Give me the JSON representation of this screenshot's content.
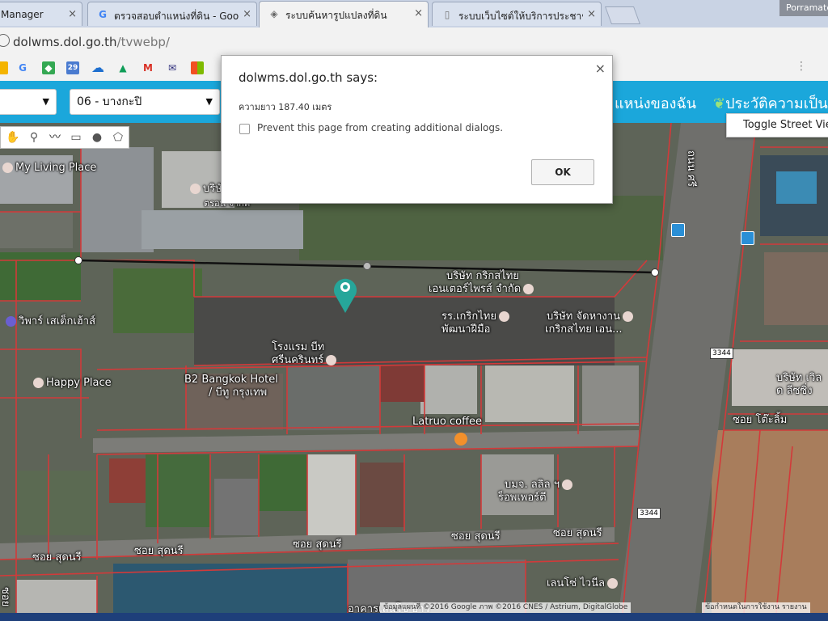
{
  "browser": {
    "tabs": [
      {
        "title": "Manager",
        "icon": "page-icon"
      },
      {
        "title": "ตรวจสอบตำแหน่งที่ดิน - Goo",
        "icon": "google-icon"
      },
      {
        "title": "ระบบค้นหารูปแปลงที่ดิน",
        "icon": "dol-icon"
      },
      {
        "title": "ระบบเว็บไซต์ให้บริการประชาช",
        "icon": "page-icon"
      }
    ],
    "profile_name": "Porramate",
    "url_host": "dolwms.dol.go.th",
    "url_path": "/tvwebp/",
    "bookmark_icons": [
      "G",
      "maps",
      "29",
      "onedrive",
      "drive",
      "gmail",
      "mail",
      "windows"
    ]
  },
  "site": {
    "province_select": "",
    "district_select": "06 - บางกะปิ",
    "nav_my_location": "แหน่งของฉัน",
    "nav_history": "ประวัติความเป็น"
  },
  "map": {
    "toggle_street_view": "Toggle Street View",
    "labels": {
      "my_living_place": "My Living Place",
      "company_top_1": "บริษั",
      "company_top_2": "ตรอน จำกัด",
      "grik_company_1": "บริษัท กริกสไทย",
      "grik_company_2": "เอนเตอร์ไพรส์ จำกัด",
      "school_1": "รร.เกริกไทย",
      "school_2": "พัฒนาฝีมือ",
      "job_company_1": "บริษัท จัดหางาน",
      "job_company_2": "เกริกสไทย เอน...",
      "hotel_1": "โรงแรม บีท",
      "hotel_2": "ศรีนครินทร์",
      "wipas": "วิพาร์ เสเต็กเฮ้าส์",
      "happy_place": "Happy Place",
      "b2_hotel_1": "B2 Bangkok Hotel",
      "b2_hotel_2": "/ บีทู กรุงเทพ",
      "latruo": "Latruo coffee",
      "bcj_1": "บมจ. ลลิล ฯ",
      "bcj_2": "ร็อพเพอร์ตี",
      "right_company_1": "บริษัท เวิล",
      "right_company_2": "ด ลีซซิ่ง",
      "lenso": "เลนโซ่ ไวนีล",
      "bottom_building": "อาคารเลนโซ่ ฮ้าว",
      "soi_tomlim": "ซอย โต๊ะลิ้ม",
      "soi_sudnee_1": "ซอย สุดนรี",
      "soi_sudnee_2": "ซอย สุดนรี",
      "soi_sudnee_3": "ซอย สุดนรี",
      "soi_sudnee_4": "ซอย สุดนรี",
      "soi_sudnee_5": "ซอย สุดนรี",
      "road_name": "ถนน ศรี",
      "left_edge": "ซอย"
    },
    "road_signs": [
      "3344",
      "3344"
    ],
    "copyright": "ข้อมูลแผนที่ ©2016 Google ภาพ ©2016 CNES / Astrium, DigitalGlobe",
    "copyright_right": "ข้อกำหนดในการใช้งาน รายงาน"
  },
  "dialog": {
    "title": "dolwms.dol.go.th says:",
    "message": "ความยาว 187.40 เมตร",
    "checkbox_label": "Prevent this page from creating additional dialogs.",
    "ok_label": "OK"
  },
  "colors": {
    "header_blue": "#1ba7db",
    "parcel_red": "#d23a3a",
    "measure_line": "#111111"
  }
}
